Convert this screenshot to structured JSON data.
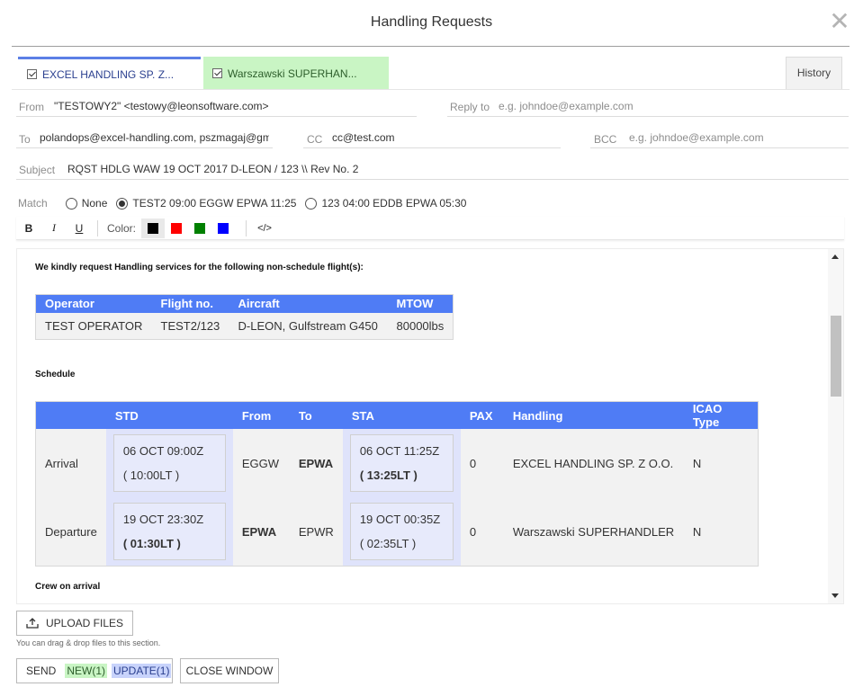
{
  "window": {
    "title": "Handling Requests",
    "close_glyph": "✕"
  },
  "tabs": [
    {
      "label": "EXCEL HANDLING SP. Z...",
      "checked": true,
      "active": true
    },
    {
      "label": "Warszawski SUPERHAN...",
      "checked": true,
      "active": false
    }
  ],
  "history_label": "History",
  "fields": {
    "from_label": "From",
    "from_value": "\"TESTOWY2\" <testowy@leonsoftware.com>",
    "reply_to_label": "Reply to",
    "reply_to_placeholder": "e.g. johndoe@example.com",
    "to_label": "To",
    "to_value": "polandops@excel-handling.com, pszmagaj@gm",
    "cc_label": "CC",
    "cc_value": "cc@test.com",
    "bcc_label": "BCC",
    "bcc_placeholder": "e.g. johndoe@example.com",
    "subject_label": "Subject",
    "subject_value": "RQST HDLG  WAW 19 OCT 2017  D-LEON / 123 \\\\ Rev No. 2"
  },
  "match": {
    "label": "Match",
    "options": [
      {
        "label": "None",
        "checked": false
      },
      {
        "label": "TEST2 09:00 EGGW EPWA 11:25",
        "checked": true
      },
      {
        "label": "123 04:00 EDDB EPWA 05:30",
        "checked": false
      }
    ]
  },
  "toolbar": {
    "bold": "B",
    "italic": "I",
    "underline": "U",
    "color_label": "Color:",
    "colors": [
      "#000000",
      "#ff0000",
      "#008000",
      "#0000ff"
    ],
    "code": "</>"
  },
  "editor": {
    "intro": "We kindly request Handling services for the following non-schedule flight(s):",
    "operator_table": {
      "headers": [
        "Operator",
        "Flight no.",
        "Aircraft",
        "MTOW"
      ],
      "row": [
        "TEST OPERATOR",
        "TEST2/123",
        "D-LEON, Gulfstream G450",
        "80000lbs"
      ]
    },
    "schedule_title": "Schedule",
    "schedule_table": {
      "headers": [
        "",
        "STD",
        "From",
        "To",
        "STA",
        "PAX",
        "Handling",
        "ICAO Type"
      ],
      "rows": [
        {
          "type": "Arrival",
          "std_utc": "06 OCT 09:00Z",
          "std_lt": "( 10:00LT )",
          "from": "EGGW",
          "to": "EPWA",
          "sta_utc": "06 OCT 11:25Z",
          "sta_lt": "( 13:25LT )",
          "pax": "0",
          "handling": "EXCEL HANDLING SP. Z O.O.",
          "icao": "N"
        },
        {
          "type": "Departure",
          "std_utc": "19 OCT 23:30Z",
          "std_lt": "( 01:30LT )",
          "from": "EPWA",
          "to": "EPWR",
          "sta_utc": "19 OCT 00:35Z",
          "sta_lt": "( 02:35LT )",
          "pax": "0",
          "handling": "Warszawski SUPERHANDLER",
          "icao": "N"
        }
      ]
    },
    "crew_title": "Crew on arrival"
  },
  "upload": {
    "label": "UPLOAD FILES",
    "note": "You can drag & drop files to this section."
  },
  "actions": {
    "send": "SEND",
    "new_badge": "NEW(1)",
    "update_badge": "UPDATE(1)",
    "close": "CLOSE WINDOW"
  }
}
